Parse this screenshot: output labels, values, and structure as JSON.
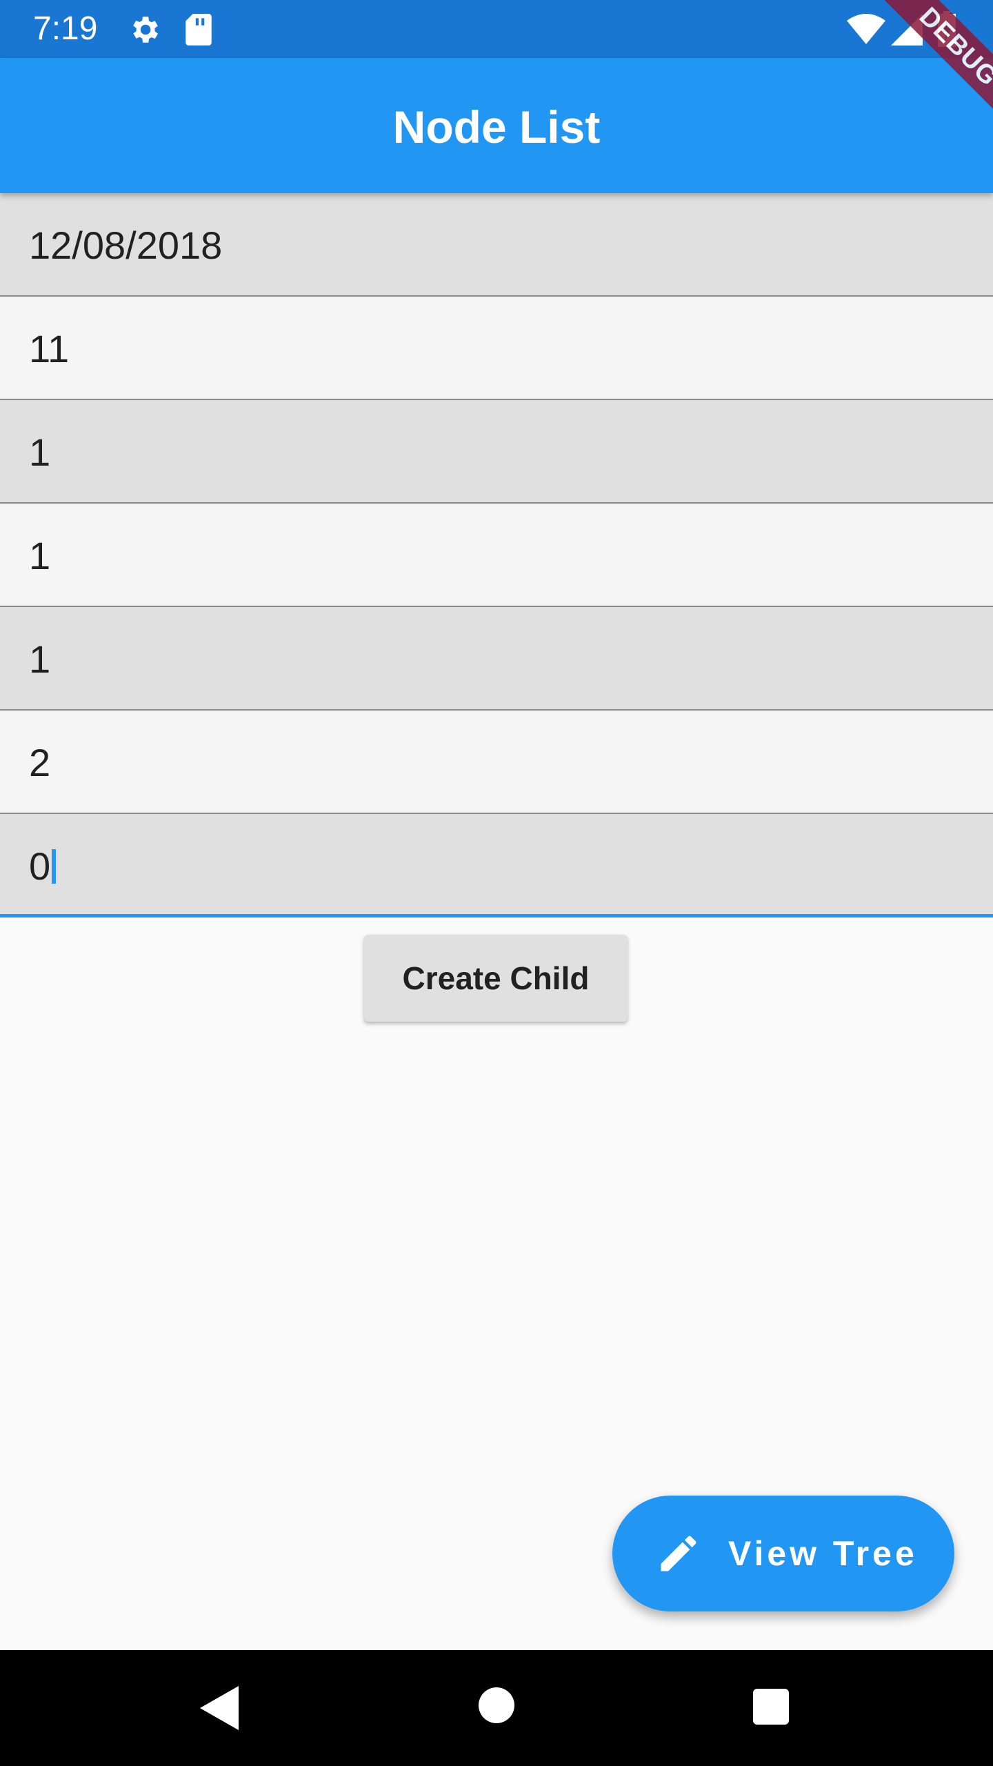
{
  "status_bar": {
    "time": "7:19",
    "icons": [
      "settings-icon",
      "sd-card-icon",
      "wifi-icon",
      "signal-icon",
      "battery-charging-icon"
    ]
  },
  "app_bar": {
    "title": "Node List"
  },
  "debug_banner": {
    "label": "DEBUG"
  },
  "rows": [
    "12/08/2018",
    "11",
    "1",
    "1",
    "1",
    "2",
    "0"
  ],
  "create_child_button": {
    "label": "Create Child"
  },
  "fab": {
    "label": "View Tree",
    "icon": "pencil-icon"
  },
  "nav_bar": {
    "icons": [
      "back-icon",
      "home-icon",
      "recents-icon"
    ]
  },
  "colors": {
    "primary": "#2196f3",
    "primary_dark": "#1976d2",
    "row_shade": "#e0e0e0",
    "row_light": "#f5f5f5"
  }
}
